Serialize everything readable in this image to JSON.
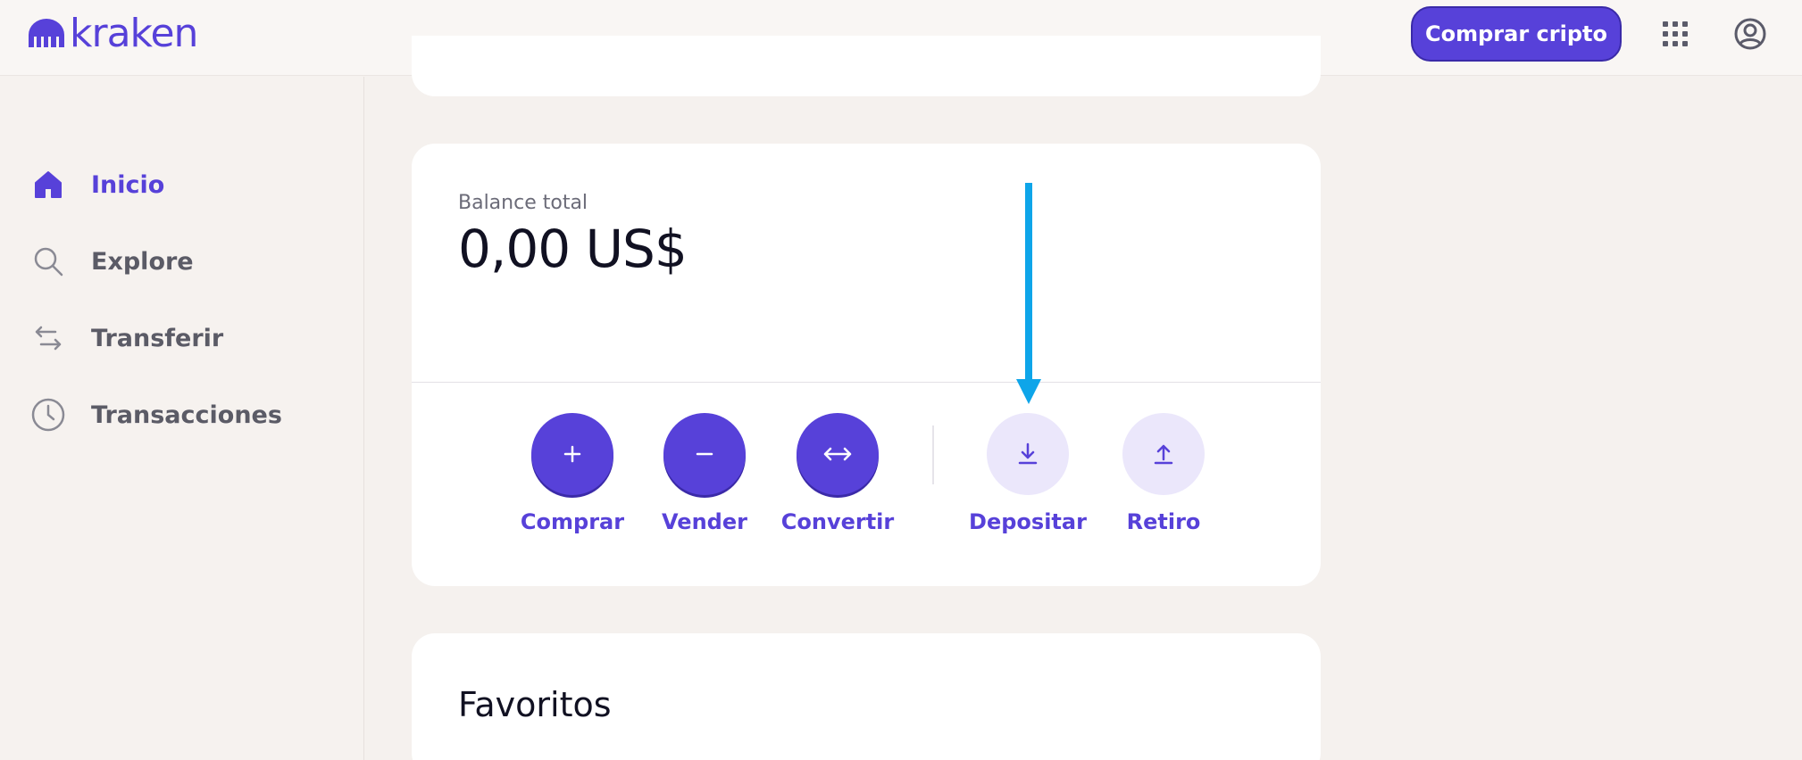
{
  "header": {
    "logo_text": "kraken",
    "buy_button_label": "Comprar cripto",
    "apps_icon": "grid-icon",
    "profile_icon": "user-circle-icon"
  },
  "sidebar": {
    "items": [
      {
        "label": "Inicio",
        "icon": "home-icon",
        "active": true
      },
      {
        "label": "Explore",
        "icon": "search-icon",
        "active": false
      },
      {
        "label": "Transferir",
        "icon": "transfer-arrows-icon",
        "active": false
      },
      {
        "label": "Transacciones",
        "icon": "clock-icon",
        "active": false
      }
    ]
  },
  "balance_card": {
    "label": "Balance total",
    "value": "0,00 US$",
    "actions": [
      {
        "label": "Comprar",
        "icon": "plus-icon",
        "style": "primary"
      },
      {
        "label": "Vender",
        "icon": "minus-icon",
        "style": "primary"
      },
      {
        "label": "Convertir",
        "icon": "swap-horizontal-icon",
        "style": "primary"
      },
      {
        "label": "Depositar",
        "icon": "download-icon",
        "style": "secondary"
      },
      {
        "label": "Retiro",
        "icon": "upload-icon",
        "style": "secondary"
      }
    ]
  },
  "favorites": {
    "title": "Favoritos"
  },
  "colors": {
    "brand": "#5741d9",
    "annotation_arrow": "#0ea5e9",
    "background": "#f5f1ee"
  }
}
